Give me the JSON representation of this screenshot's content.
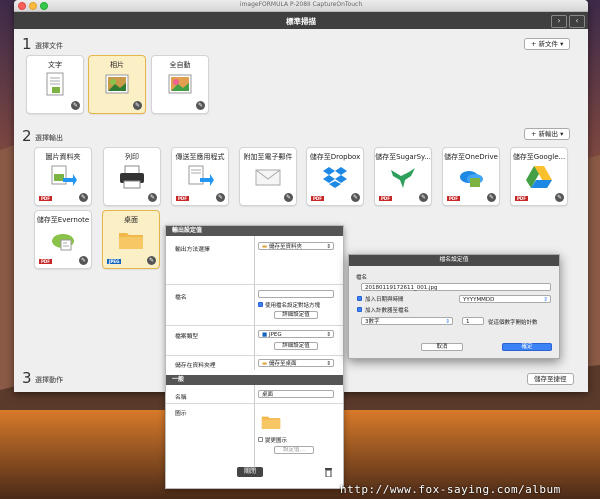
{
  "window": {
    "title": "imageFORMULA P-208II CaptureOnTouch"
  },
  "toolbar": {
    "title": "標準掃描",
    "nav_prev": "›",
    "nav_next": "‹"
  },
  "section1": {
    "number": "1",
    "label": "選擇文件",
    "button": "+ 新文件 ▾",
    "tiles": [
      {
        "label": "文字",
        "icon": "text-document-icon"
      },
      {
        "label": "相片",
        "icon": "photo-document-icon",
        "selected": true
      },
      {
        "label": "全自動",
        "icon": "auto-document-icon"
      }
    ]
  },
  "section2": {
    "number": "2",
    "label": "選擇輸出",
    "button": "+ 新輸出 ▾",
    "tiles": [
      {
        "label": "圖片資料夾",
        "icon": "folder-output-icon",
        "badge": "PDF"
      },
      {
        "label": "列印",
        "icon": "printer-icon",
        "badge": ""
      },
      {
        "label": "傳送至應用程式",
        "icon": "app-output-icon",
        "badge": "PDF"
      },
      {
        "label": "附加至電子郵件",
        "icon": "envelope-icon",
        "badge": ""
      },
      {
        "label": "儲存至Dropbox",
        "icon": "dropbox-icon",
        "badge": "PDF"
      },
      {
        "label": "儲存至SugarSy...",
        "icon": "hummingbird-icon",
        "badge": "PDF"
      },
      {
        "label": "儲存至OneDrive",
        "icon": "onedrive-icon",
        "badge": "PDF"
      },
      {
        "label": "儲存至Google...",
        "icon": "google-drive-icon",
        "badge": "PDF"
      },
      {
        "label": "儲存至Evernote",
        "icon": "evernote-icon",
        "badge": "PDF"
      },
      {
        "label": "桌面",
        "icon": "folder-icon",
        "badge": "JPEG",
        "selected": true
      }
    ]
  },
  "section3": {
    "number": "3",
    "label": "選擇動作",
    "button": "儲存至捷徑"
  },
  "panel": {
    "header": "輸出設定值",
    "output_method_label": "輸出方法選擇",
    "output_method_value": "儲存至資料夾",
    "filename_label": "檔名",
    "filename_value": "",
    "use_filename_rule": "使用檔名設定對話方塊",
    "detail_settings": "詳細設定值",
    "filetype_label": "檔案類型",
    "filetype_value": "JPEG",
    "filetype_detail": "詳細設定值",
    "save_in_label": "儲存在資料夾裡",
    "save_in_value": "儲存至桌面",
    "general_header": "一般",
    "name_label": "名稱",
    "name_value": "桌面",
    "icon_label": "圖示",
    "change_icon": "變更圖示",
    "icon_settings": "設定值…",
    "close_button": "關閉"
  },
  "dialog": {
    "title": "檔名設定值",
    "filename_label": "檔名",
    "filename_value": "20180119172611_001.jpg",
    "add_date": "加入日期與時間",
    "date_format": "YYYYMMDD",
    "add_counter": "加入計數器至檔名",
    "digits": "3數字",
    "counter_start": "1",
    "counter_note": "從這個數字開始計數",
    "cancel": "取消",
    "ok": "確定"
  },
  "watermark": "http://www.fox-saying.com/album",
  "colors": {
    "selected_bg": "#fbefc6",
    "selected_border": "#e5b74a",
    "toolbar": "#3f3f3f",
    "primary_button": "#3b82f6"
  }
}
